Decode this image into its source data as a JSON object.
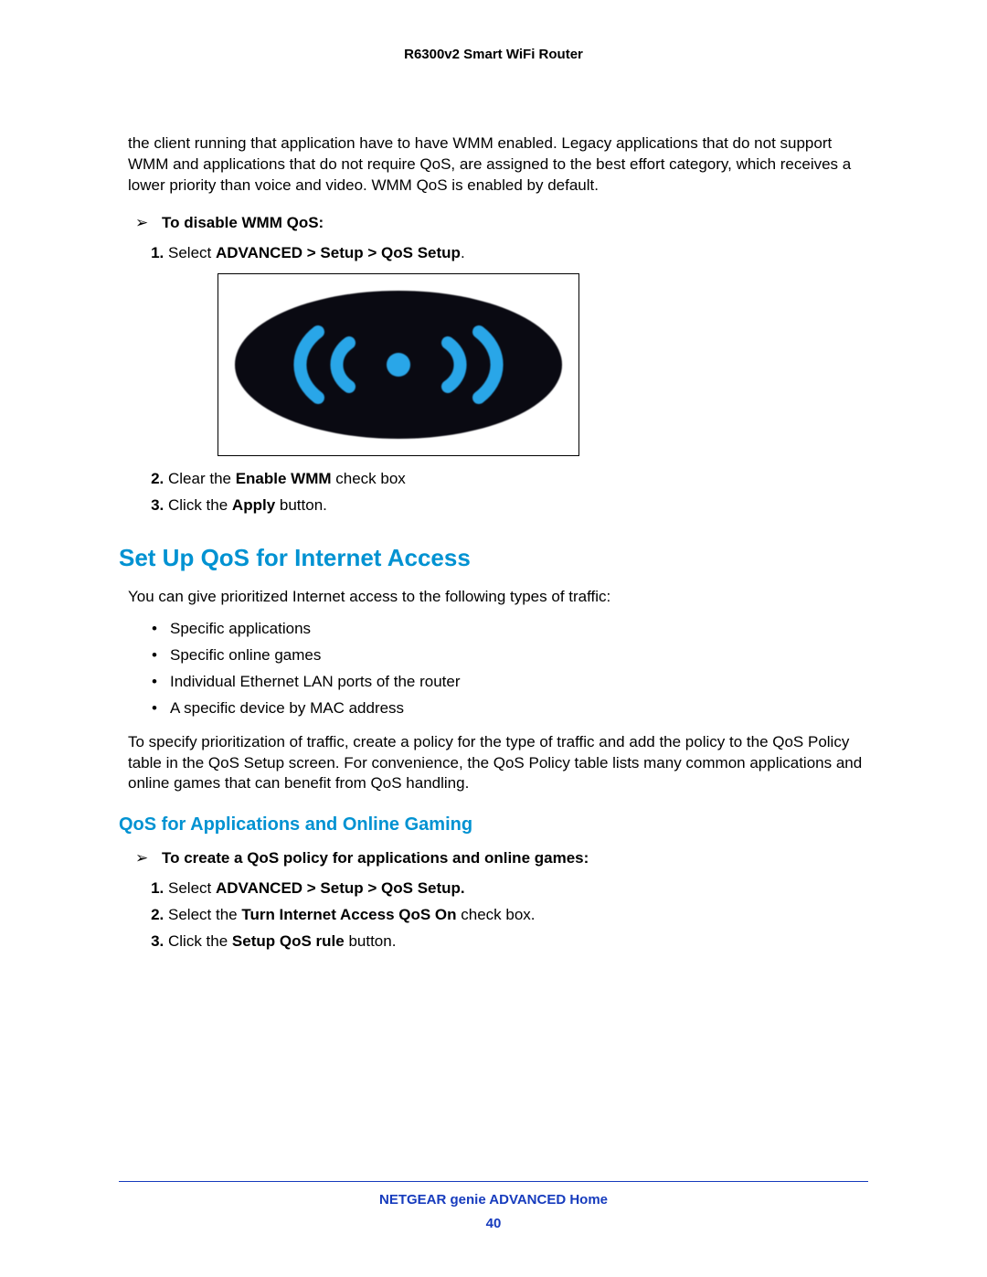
{
  "header": "R6300v2 Smart WiFi Router",
  "intro": "the client running that application have to have WMM enabled. Legacy applications that do not support WMM and applications that do not require QoS, are assigned to the best effort category, which receives a lower priority than voice and video. WMM QoS is enabled by default.",
  "task1": {
    "title": "To disable WMM QoS:",
    "step1_pre": "Select ",
    "step1_bold": "ADVANCED > Setup > QoS Setup",
    "step1_post": ".",
    "step2_pre": "Clear the ",
    "step2_bold": "Enable WMM",
    "step2_post": " check box",
    "step3_pre": "Click the ",
    "step3_bold": "Apply",
    "step3_post": " button."
  },
  "section1": "Set Up QoS for Internet Access",
  "para1": "You can give prioritized Internet access to the following types of traffic:",
  "bullets": [
    "Specific applications",
    "Specific online games",
    "Individual Ethernet LAN ports of the router",
    "A specific device by MAC address"
  ],
  "para2": "To specify prioritization of traffic, create a policy for the type of traffic and add the policy to the QoS Policy table in the QoS Setup screen. For convenience, the QoS Policy table lists many common applications and online games that can benefit from QoS handling.",
  "section2": "QoS for Applications and Online Gaming",
  "task2": {
    "title": "To create a QoS policy for applications and online games:",
    "step1_pre": "Select ",
    "step1_bold": "ADVANCED > Setup > QoS Setup.",
    "step2_pre": "Select the ",
    "step2_bold": "Turn Internet Access QoS On",
    "step2_post": " check box.",
    "step3_pre": "Click the ",
    "step3_bold": "Setup QoS rule",
    "step3_post": " button."
  },
  "footer": {
    "title": "NETGEAR genie ADVANCED Home",
    "page": "40"
  }
}
